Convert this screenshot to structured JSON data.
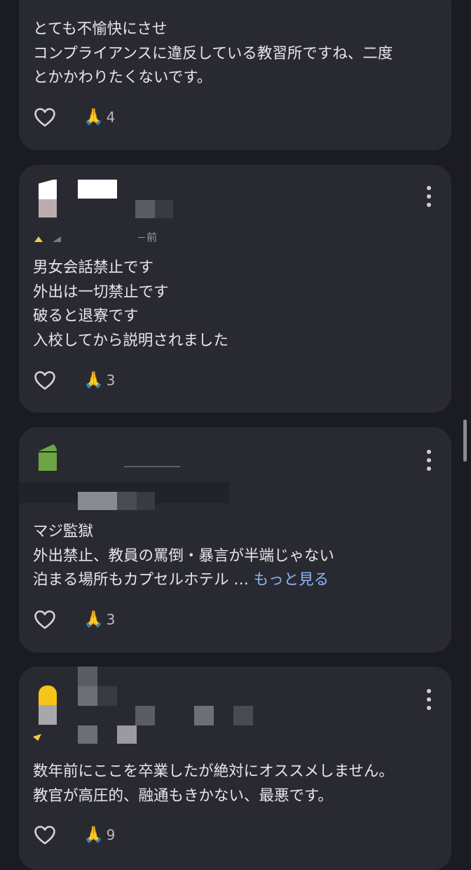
{
  "reviews": [
    {
      "lines": [
        "とても不愉快にさせ",
        "コンプライアンスに違反している教習所ですね、二度",
        "とかかわりたくないです。"
      ],
      "count": "4"
    },
    {
      "meta": "前",
      "lines": [
        "男女会話禁止です",
        "外出は一切禁止です",
        "破ると退寮です",
        "入校してから説明されました"
      ],
      "count": "3"
    },
    {
      "lines": [
        "マジ監獄",
        "外出禁止、教員の罵倒・暴言が半端じゃない",
        "泊まる場所もカプセルホテル … "
      ],
      "more": "もっと見る",
      "count": "3"
    },
    {
      "lines": [
        "数年前にここを卒業したが絶対にオススメしません。",
        "教官が高圧的、融通もきかない、最悪です。"
      ],
      "count": "9"
    }
  ],
  "icons": {
    "like": "heart-outline-icon",
    "reaction": "folded-hands-emoji",
    "menu": "more-vertical-icon"
  },
  "colors": {
    "background": "#1b1c21",
    "card": "#292a31",
    "link": "#8ab4f8"
  }
}
